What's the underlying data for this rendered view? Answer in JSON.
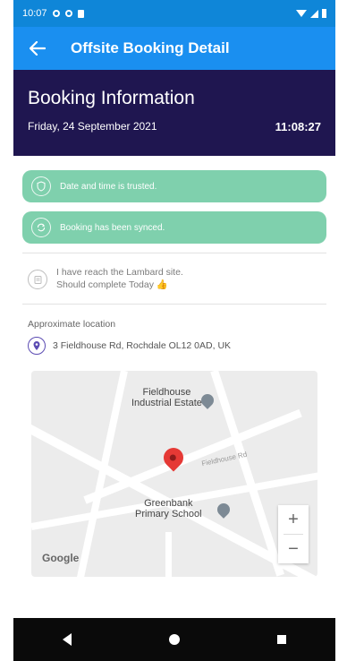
{
  "statusbar": {
    "time": "10:07"
  },
  "appbar": {
    "title": "Offsite Booking Detail"
  },
  "booking": {
    "heading": "Booking Information",
    "date": "Friday, 24 September 2021",
    "time": "11:08:27"
  },
  "notices": [
    {
      "text": "Date and time is trusted.",
      "icon": "shield-check-icon"
    },
    {
      "text": "Booking has been synced.",
      "icon": "sync-icon"
    }
  ],
  "message": {
    "line1": "I have reach the Lambard site.",
    "line2": "Should complete Today 👍"
  },
  "location": {
    "label": "Approximate location",
    "address": "3 Fieldhouse Rd, Rochdale OL12 0AD, UK"
  },
  "map": {
    "label_estate_1": "Fieldhouse",
    "label_estate_2": "Industrial Estate",
    "label_school_1": "Greenbank",
    "label_school_2": "Primary School",
    "road_fieldhouse": "Fieldhouse Rd",
    "zoom_in": "+",
    "zoom_out": "−",
    "google": "Google"
  },
  "colors": {
    "statusbar": "#0f86d8",
    "appbar": "#1a8ff0",
    "header": "#1f1650",
    "notice": "#7fd0ad",
    "pin": "#e53935"
  }
}
